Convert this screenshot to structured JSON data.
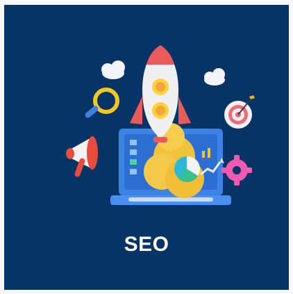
{
  "card": {
    "title": "SEO",
    "background_color": "#063467",
    "title_color": "#ffffff"
  },
  "illustration": {
    "elements": [
      "rocket-icon",
      "cloud-icon",
      "magnifier-icon",
      "target-icon",
      "megaphone-icon",
      "laptop-icon",
      "pie-chart-icon",
      "gear-icon",
      "growth-arrow-icon"
    ]
  }
}
